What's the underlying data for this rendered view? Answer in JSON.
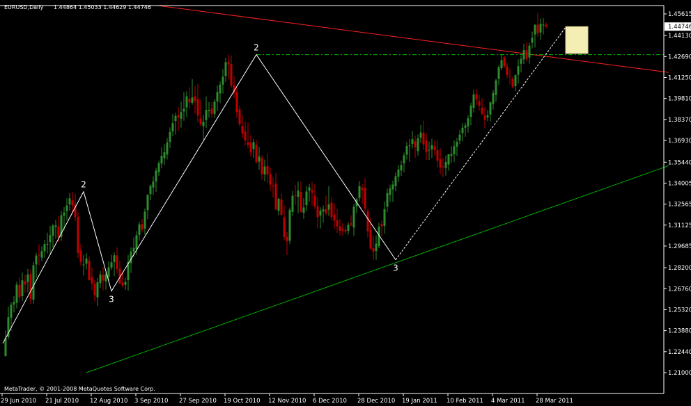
{
  "header": {
    "symbol_tf": "EURUSD,Daily",
    "ohlc": "1.44864 1.45033 1.44629 1.44746"
  },
  "footer": {
    "copyright": "MetaTrader, © 2001-2008 MetaQuotes Software Corp."
  },
  "colors": {
    "background": "#000000",
    "frame": "#ffffff",
    "bull_candle": "#2e8b2e",
    "bear_candle": "#c00000",
    "resistance_line": "#ff2020",
    "support_line": "#00b000",
    "level_line": "#00c000",
    "wave_line": "#ffffff",
    "box": "#f5eeb4"
  },
  "chart_data": {
    "type": "candlestick",
    "symbol": "EURUSD",
    "timeframe": "Daily",
    "y_ticks": [
      1.45615,
      1.4413,
      1.4269,
      1.4125,
      1.3981,
      1.3837,
      1.3693,
      1.3544,
      1.34005,
      1.32565,
      1.31125,
      1.29685,
      1.282,
      1.2676,
      1.2532,
      1.2388,
      1.2244,
      1.21
    ],
    "y_tick_labels": [
      "1.45615",
      "1.44130",
      "1.42690",
      "1.41250",
      "1.39810",
      "1.38370",
      "1.36930",
      "1.35440",
      "1.34005",
      "1.32565",
      "1.31125",
      "1.29685",
      "1.28200",
      "1.26760",
      "1.25320",
      "1.23880",
      "1.22440",
      "1.21000"
    ],
    "x_tick_labels": [
      "29 Jun 2010",
      "21 Jul 2010",
      "12 Aug 2010",
      "3 Sep 2010",
      "27 Sep 2010",
      "19 Oct 2010",
      "12 Nov 2010",
      "6 Dec 2010",
      "28 Dec 2010",
      "19 Jan 2011",
      "10 Feb 2011",
      "4 Mar 2011",
      "28 Mar 2011"
    ],
    "x_tick_bar_index": [
      0,
      16,
      32,
      48,
      64,
      80,
      96,
      112,
      128,
      144,
      160,
      176,
      192
    ],
    "current_price": 1.44746,
    "current_price_label": "1.44746",
    "ohlc_bars": [
      [
        1.2213,
        1.239,
        1.2213,
        1.2338
      ],
      [
        1.2344,
        1.2553,
        1.2328,
        1.2481
      ],
      [
        1.2476,
        1.2583,
        1.2387,
        1.2565
      ],
      [
        1.2566,
        1.2624,
        1.2513,
        1.2584
      ],
      [
        1.2579,
        1.2725,
        1.2541,
        1.2703
      ],
      [
        1.2703,
        1.2753,
        1.2581,
        1.2618
      ],
      [
        1.2625,
        1.2788,
        1.2592,
        1.2733
      ],
      [
        1.2728,
        1.2772,
        1.2649,
        1.2705
      ],
      [
        1.2723,
        1.2811,
        1.2652,
        1.2774
      ],
      [
        1.2777,
        1.2808,
        1.2571,
        1.2605
      ],
      [
        1.2601,
        1.286,
        1.2573,
        1.2837
      ],
      [
        1.2842,
        1.2922,
        1.2748,
        1.2903
      ],
      [
        1.2908,
        1.298,
        1.2835,
        1.2905
      ],
      [
        1.2889,
        1.2966,
        1.2863,
        1.2934
      ],
      [
        1.2933,
        1.3011,
        1.2888,
        1.2982
      ],
      [
        1.2983,
        1.306,
        1.2918,
        1.2984
      ],
      [
        1.2996,
        1.3107,
        1.2919,
        1.3043
      ],
      [
        1.3039,
        1.3122,
        1.2957,
        1.3109
      ],
      [
        1.3101,
        1.3149,
        1.3017,
        1.311
      ],
      [
        1.3104,
        1.3173,
        1.2998,
        1.3028
      ],
      [
        1.3031,
        1.3211,
        1.3005,
        1.318
      ],
      [
        1.3176,
        1.3236,
        1.3077,
        1.3199
      ],
      [
        1.3208,
        1.3296,
        1.3147,
        1.3247
      ],
      [
        1.3254,
        1.3333,
        1.3212,
        1.3296
      ],
      [
        1.3282,
        1.3342,
        1.3194,
        1.3249
      ],
      [
        1.3254,
        1.3329,
        1.3139,
        1.3167
      ],
      [
        1.3168,
        1.32,
        1.2887,
        1.2921
      ],
      [
        1.2939,
        1.2981,
        1.2836,
        1.2859
      ],
      [
        1.2842,
        1.2908,
        1.2768,
        1.2842
      ],
      [
        1.2847,
        1.292,
        1.2808,
        1.2883
      ],
      [
        1.2868,
        1.2898,
        1.2732,
        1.2735
      ],
      [
        1.2755,
        1.2823,
        1.2667,
        1.2712
      ],
      [
        1.2709,
        1.2735,
        1.2589,
        1.263
      ],
      [
        1.2617,
        1.275,
        1.2557,
        1.272
      ],
      [
        1.2714,
        1.2798,
        1.268,
        1.2774
      ],
      [
        1.2771,
        1.2825,
        1.2663,
        1.2731
      ],
      [
        1.2727,
        1.2798,
        1.2669,
        1.2775
      ],
      [
        1.2757,
        1.2863,
        1.2723,
        1.2823
      ],
      [
        1.2821,
        1.2909,
        1.2805,
        1.2857
      ],
      [
        1.2859,
        1.2926,
        1.2762,
        1.2905
      ],
      [
        1.2905,
        1.2959,
        1.2781,
        1.281
      ],
      [
        1.2814,
        1.2868,
        1.2706,
        1.2712
      ],
      [
        1.2717,
        1.2793,
        1.2684,
        1.2698
      ],
      [
        1.2702,
        1.275,
        1.2668,
        1.2722
      ],
      [
        1.2735,
        1.2909,
        1.2663,
        1.2858
      ],
      [
        1.2851,
        1.296,
        1.2784,
        1.2931
      ],
      [
        1.2931,
        1.3028,
        1.2893,
        1.2956
      ],
      [
        1.2947,
        1.3072,
        1.2907,
        1.3043
      ],
      [
        1.3045,
        1.3136,
        1.3006,
        1.3117
      ],
      [
        1.312,
        1.3154,
        1.3062,
        1.3081
      ],
      [
        1.3089,
        1.3227,
        1.3046,
        1.3205
      ],
      [
        1.3215,
        1.3325,
        1.3153,
        1.332
      ],
      [
        1.3325,
        1.3391,
        1.3283,
        1.3382
      ],
      [
        1.337,
        1.3447,
        1.332,
        1.3411
      ],
      [
        1.3412,
        1.3505,
        1.3339,
        1.3486
      ],
      [
        1.3476,
        1.3553,
        1.345,
        1.3538
      ],
      [
        1.3534,
        1.3647,
        1.3501,
        1.3588
      ],
      [
        1.3571,
        1.3668,
        1.3525,
        1.3612
      ],
      [
        1.3597,
        1.3709,
        1.3563,
        1.368
      ],
      [
        1.3684,
        1.3782,
        1.364,
        1.3752
      ],
      [
        1.3755,
        1.3875,
        1.3723,
        1.3812
      ],
      [
        1.3826,
        1.3883,
        1.3733,
        1.3862
      ],
      [
        1.3867,
        1.3923,
        1.3758,
        1.3851
      ],
      [
        1.3842,
        1.3959,
        1.3781,
        1.3888
      ],
      [
        1.3891,
        1.4024,
        1.3828,
        1.3911
      ],
      [
        1.392,
        1.403,
        1.3853,
        1.3996
      ],
      [
        1.3979,
        1.4059,
        1.391,
        1.3954
      ],
      [
        1.3951,
        1.4114,
        1.3938,
        1.3988
      ],
      [
        1.3997,
        1.4069,
        1.3878,
        1.3963
      ],
      [
        1.3977,
        1.4082,
        1.3817,
        1.3865
      ],
      [
        1.3844,
        1.397,
        1.379,
        1.3804
      ],
      [
        1.3791,
        1.387,
        1.3695,
        1.3821
      ],
      [
        1.3833,
        1.3995,
        1.3778,
        1.3902
      ],
      [
        1.3895,
        1.3956,
        1.3849,
        1.3903
      ],
      [
        1.3911,
        1.3955,
        1.3848,
        1.3876
      ],
      [
        1.3875,
        1.3978,
        1.3847,
        1.396
      ],
      [
        1.3961,
        1.4071,
        1.3896,
        1.4025
      ],
      [
        1.4016,
        1.4098,
        1.395,
        1.4076
      ],
      [
        1.4076,
        1.4182,
        1.4015,
        1.413
      ],
      [
        1.4135,
        1.4261,
        1.4094,
        1.4231
      ],
      [
        1.423,
        1.4282,
        1.4111,
        1.4216
      ],
      [
        1.4218,
        1.4275,
        1.4052,
        1.407
      ],
      [
        1.4072,
        1.4133,
        1.3983,
        1.4019
      ],
      [
        1.4023,
        1.4057,
        1.3847,
        1.3887
      ],
      [
        1.3906,
        1.3932,
        1.3787,
        1.3807
      ],
      [
        1.3792,
        1.3867,
        1.3712,
        1.3741
      ],
      [
        1.3754,
        1.3825,
        1.3658,
        1.3693
      ],
      [
        1.3679,
        1.3816,
        1.3641,
        1.3662
      ],
      [
        1.3679,
        1.3729,
        1.3582,
        1.3611
      ],
      [
        1.3633,
        1.3704,
        1.3574,
        1.3682
      ],
      [
        1.3662,
        1.3693,
        1.3535,
        1.3544
      ],
      [
        1.3548,
        1.3649,
        1.3492,
        1.3583
      ],
      [
        1.3573,
        1.3592,
        1.3424,
        1.3461
      ],
      [
        1.3461,
        1.3562,
        1.3413,
        1.3514
      ],
      [
        1.3517,
        1.3604,
        1.3403,
        1.3458
      ],
      [
        1.3463,
        1.3503,
        1.3348,
        1.339
      ],
      [
        1.3385,
        1.3439,
        1.3302,
        1.3379
      ],
      [
        1.3398,
        1.3469,
        1.3215,
        1.322
      ],
      [
        1.321,
        1.33,
        1.318,
        1.3293
      ],
      [
        1.3289,
        1.3329,
        1.3178,
        1.3183
      ],
      [
        1.3165,
        1.3247,
        1.3009,
        1.303
      ],
      [
        1.3031,
        1.3065,
        1.2907,
        1.3001
      ],
      [
        1.3005,
        1.3233,
        1.2983,
        1.3217
      ],
      [
        1.3202,
        1.3347,
        1.3176,
        1.3314
      ],
      [
        1.3318,
        1.3389,
        1.325,
        1.3314
      ],
      [
        1.3307,
        1.3412,
        1.3193,
        1.3349
      ],
      [
        1.3339,
        1.341,
        1.3198,
        1.3203
      ],
      [
        1.3197,
        1.3298,
        1.3155,
        1.3233
      ],
      [
        1.3249,
        1.3379,
        1.3207,
        1.3343
      ],
      [
        1.3349,
        1.3393,
        1.3273,
        1.3371
      ],
      [
        1.3353,
        1.3408,
        1.3244,
        1.3335
      ],
      [
        1.3313,
        1.3393,
        1.3225,
        1.3242
      ],
      [
        1.324,
        1.3302,
        1.309,
        1.3167
      ],
      [
        1.3178,
        1.3234,
        1.3089,
        1.3212
      ],
      [
        1.3206,
        1.3247,
        1.3128,
        1.322
      ],
      [
        1.3221,
        1.3316,
        1.3181,
        1.3195
      ],
      [
        1.3218,
        1.3379,
        1.3175,
        1.3255
      ],
      [
        1.3266,
        1.3303,
        1.3143,
        1.3168
      ],
      [
        1.3184,
        1.3261,
        1.3087,
        1.3143
      ],
      [
        1.3146,
        1.3224,
        1.3058,
        1.3103
      ],
      [
        1.3104,
        1.3153,
        1.3042,
        1.3073
      ],
      [
        1.3085,
        1.3125,
        1.3039,
        1.3075
      ],
      [
        1.308,
        1.3111,
        1.3055,
        1.307
      ],
      [
        1.3073,
        1.3133,
        1.3047,
        1.3115
      ],
      [
        1.3125,
        1.3179,
        1.3104,
        1.3114
      ],
      [
        1.3096,
        1.3258,
        1.3039,
        1.3238
      ],
      [
        1.324,
        1.33,
        1.3195,
        1.329
      ],
      [
        1.3299,
        1.3414,
        1.3276,
        1.3379
      ],
      [
        1.3369,
        1.3392,
        1.3257,
        1.3353
      ],
      [
        1.3368,
        1.3434,
        1.32,
        1.3226
      ],
      [
        1.3208,
        1.3226,
        1.3027,
        1.3071
      ],
      [
        1.308,
        1.316,
        1.2944,
        1.2951
      ],
      [
        1.2953,
        1.3039,
        1.2874,
        1.2931
      ],
      [
        1.2935,
        1.3042,
        1.2874,
        1.2985
      ],
      [
        1.2968,
        1.3128,
        1.2954,
        1.3102
      ],
      [
        1.3119,
        1.3142,
        1.3036,
        1.3104
      ],
      [
        1.3107,
        1.3274,
        1.3054,
        1.3222
      ],
      [
        1.3238,
        1.3363,
        1.32,
        1.3332
      ],
      [
        1.332,
        1.339,
        1.3271,
        1.3363
      ],
      [
        1.3357,
        1.3417,
        1.3272,
        1.3391
      ],
      [
        1.338,
        1.3474,
        1.3344,
        1.3448
      ],
      [
        1.3443,
        1.3524,
        1.3408,
        1.3494
      ],
      [
        1.3487,
        1.3555,
        1.345,
        1.3525
      ],
      [
        1.3535,
        1.361,
        1.3474,
        1.3591
      ],
      [
        1.3595,
        1.3683,
        1.3562,
        1.3656
      ],
      [
        1.3655,
        1.3704,
        1.3547,
        1.3659
      ],
      [
        1.3669,
        1.3759,
        1.3638,
        1.3702
      ],
      [
        1.3688,
        1.3727,
        1.3574,
        1.3646
      ],
      [
        1.362,
        1.3734,
        1.3589,
        1.3707
      ],
      [
        1.3711,
        1.3798,
        1.3674,
        1.3747
      ],
      [
        1.3747,
        1.383,
        1.3627,
        1.3666
      ],
      [
        1.3693,
        1.374,
        1.3559,
        1.3613
      ],
      [
        1.3626,
        1.3687,
        1.356,
        1.3629
      ],
      [
        1.3633,
        1.3705,
        1.3574,
        1.3661
      ],
      [
        1.3654,
        1.3694,
        1.3588,
        1.3627
      ],
      [
        1.3627,
        1.3693,
        1.3508,
        1.3554
      ],
      [
        1.3565,
        1.364,
        1.3464,
        1.3508
      ],
      [
        1.3514,
        1.3575,
        1.3442,
        1.351
      ],
      [
        1.3504,
        1.359,
        1.3451,
        1.3546
      ],
      [
        1.3528,
        1.36,
        1.3485,
        1.3598
      ],
      [
        1.3588,
        1.3653,
        1.354,
        1.36
      ],
      [
        1.3599,
        1.3693,
        1.3546,
        1.3653
      ],
      [
        1.365,
        1.371,
        1.3587,
        1.3684
      ],
      [
        1.3692,
        1.3765,
        1.3669,
        1.3733
      ],
      [
        1.3744,
        1.3812,
        1.3687,
        1.378
      ],
      [
        1.378,
        1.3815,
        1.3718,
        1.3796
      ],
      [
        1.3791,
        1.3866,
        1.3747,
        1.3845
      ],
      [
        1.3855,
        1.3952,
        1.3797,
        1.3932
      ],
      [
        1.3918,
        1.4041,
        1.3885,
        1.4009
      ],
      [
        1.4011,
        1.4046,
        1.3936,
        1.3974
      ],
      [
        1.3962,
        1.4005,
        1.3897,
        1.3932
      ],
      [
        1.3918,
        1.3984,
        1.3864,
        1.3876
      ],
      [
        1.3865,
        1.3923,
        1.378,
        1.3835
      ],
      [
        1.3851,
        1.3901,
        1.3825,
        1.3866
      ],
      [
        1.3871,
        1.396,
        1.3824,
        1.3955
      ],
      [
        1.3944,
        1.404,
        1.3905,
        1.4019
      ],
      [
        1.4006,
        1.4117,
        1.3958,
        1.4105
      ],
      [
        1.4116,
        1.421,
        1.4074,
        1.4196
      ],
      [
        1.4189,
        1.428,
        1.4175,
        1.4245
      ],
      [
        1.4263,
        1.4271,
        1.4189,
        1.4202
      ],
      [
        1.4202,
        1.4227,
        1.4119,
        1.4141
      ],
      [
        1.4136,
        1.4186,
        1.4078,
        1.4131
      ],
      [
        1.4114,
        1.4131,
        1.4051,
        1.4062
      ],
      [
        1.4066,
        1.4145,
        1.4032,
        1.4141
      ],
      [
        1.4143,
        1.425,
        1.4084,
        1.4203
      ],
      [
        1.4219,
        1.4275,
        1.4161,
        1.4254
      ],
      [
        1.4249,
        1.4357,
        1.4218,
        1.4313
      ],
      [
        1.4313,
        1.4365,
        1.4236,
        1.4253
      ],
      [
        1.4262,
        1.4363,
        1.422,
        1.4344
      ],
      [
        1.4364,
        1.444,
        1.4325,
        1.4397
      ],
      [
        1.442,
        1.449,
        1.433,
        1.4487
      ],
      [
        1.4487,
        1.4565,
        1.4406,
        1.4431
      ],
      [
        1.4434,
        1.453,
        1.4384,
        1.4494
      ],
      [
        1.4482,
        1.4532,
        1.4421,
        1.4488
      ],
      [
        1.4486,
        1.4503,
        1.4463,
        1.4475
      ]
    ],
    "wave_labels": [
      {
        "label": "2",
        "bar": 28,
        "price": 1.3342,
        "pos": "above"
      },
      {
        "label": "3",
        "bar": 38,
        "price": 1.266,
        "pos": "below"
      },
      {
        "label": "2",
        "bar": 90,
        "price": 1.4282,
        "pos": "above"
      },
      {
        "label": "3",
        "bar": 140,
        "price": 1.2874,
        "pos": "below"
      }
    ],
    "wave_path": [
      [
        -1,
        1.23
      ],
      [
        28,
        1.3342
      ],
      [
        38,
        1.266
      ],
      [
        90,
        1.4282
      ],
      [
        140,
        1.2874
      ]
    ],
    "projection_path": [
      [
        140,
        1.2874
      ],
      [
        201,
        1.447
      ]
    ],
    "resistance_line": [
      [
        54,
        1.462
      ],
      [
        238,
        1.416
      ]
    ],
    "support_line": [
      [
        29,
        1.21
      ],
      [
        238,
        1.352
      ]
    ],
    "level_line": {
      "price": 1.4282,
      "from_bar": 90
    },
    "target_box": {
      "bar_from": 201,
      "bar_to": 209,
      "price_top": 1.4474,
      "price_bottom": 1.429
    }
  }
}
